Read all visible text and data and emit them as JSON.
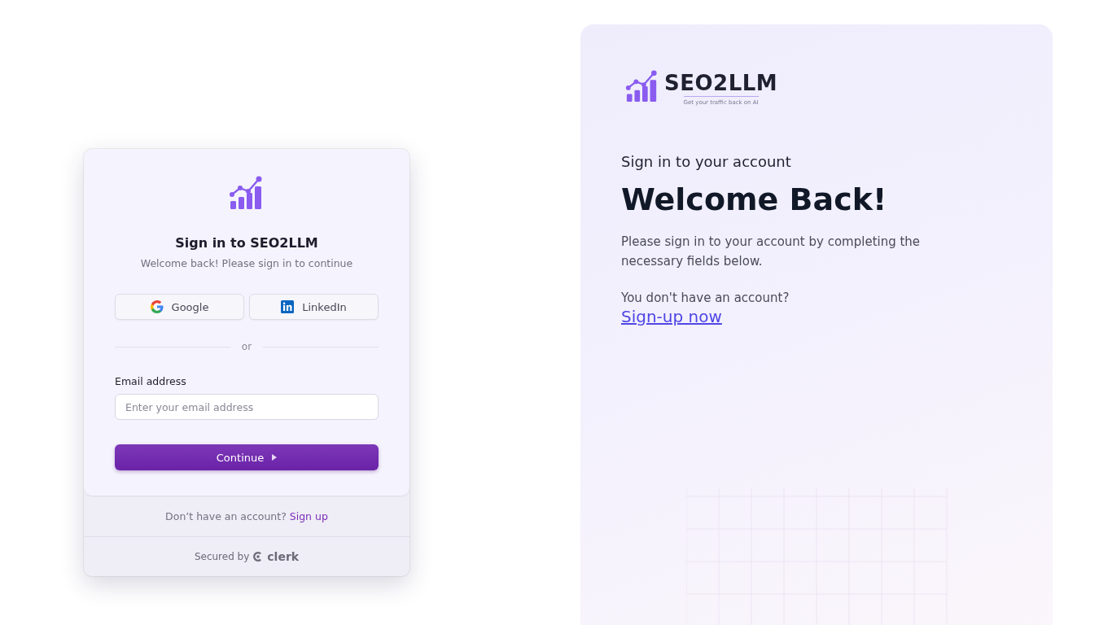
{
  "sign_in_card": {
    "title": "Sign in to SEO2LLM",
    "subtitle": "Welcome back! Please sign in to continue",
    "social_buttons": [
      {
        "kind": "google",
        "label": "Google"
      },
      {
        "kind": "linkedin",
        "label": "LinkedIn"
      }
    ],
    "divider": "or",
    "email": {
      "label": "Email address",
      "placeholder": "Enter your email address"
    },
    "continue_button": "Continue",
    "footer": {
      "prompt": "Don’t have an account?",
      "link": "Sign up"
    },
    "secured": {
      "label": "Secured by",
      "brand": "clerk"
    }
  },
  "info_panel": {
    "logo": {
      "name": "SEO2LLM",
      "tagline": "Get your traffic back on AI"
    },
    "eyebrow": "Sign in to your account",
    "heading": "Welcome Back!",
    "description": "Please sign in to your account by completing the necessary fields below.",
    "prompt": "You don't have an account?",
    "link": "Sign-up now"
  }
}
